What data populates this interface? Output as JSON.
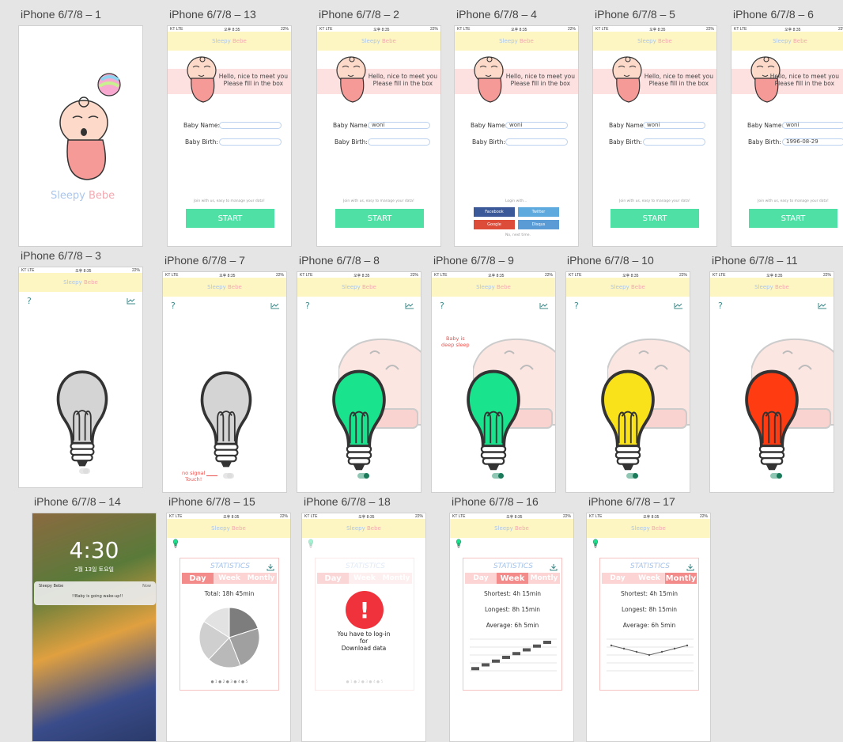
{
  "labels": {
    "s1": "iPhone 6/7/8 – 1",
    "s13": "iPhone 6/7/8 – 13",
    "s2": "iPhone 6/7/8 – 2",
    "s4": "iPhone 6/7/8 – 4",
    "s5": "iPhone 6/7/8 – 5",
    "s6": "iPhone 6/7/8 – 6",
    "s3": "iPhone 6/7/8 – 3",
    "s7": "iPhone 6/7/8 – 7",
    "s8": "iPhone 6/7/8 – 8",
    "s9": "iPhone 6/7/8 – 9",
    "s10": "iPhone 6/7/8 – 10",
    "s11": "iPhone 6/7/8 – 11",
    "s14": "iPhone 6/7/8 – 14",
    "s15": "iPhone 6/7/8 – 15",
    "s18": "iPhone 6/7/8 – 18",
    "s16": "iPhone 6/7/8 – 16",
    "s17": "iPhone 6/7/8 – 17"
  },
  "status": {
    "carrier": "KT  LTE",
    "time": "오후 8:35",
    "battery": "22%"
  },
  "brand": {
    "word1": "Sleepy",
    "word2": "Bebe"
  },
  "login": {
    "hello1": "Hello, nice to meet you",
    "hello2": "Please fill in the box",
    "name_label": "Baby Name:",
    "birth_label": "Baby Birth:",
    "name_value": "woni",
    "birth_value": "1996-08-29",
    "join": "Join with us, easy to manage your data!",
    "start": "START",
    "login_with": "Login with...",
    "social": [
      "Facebook",
      "Twitter",
      "Google",
      "Disqus"
    ],
    "no_next": "No, next time."
  },
  "monitor": {
    "help": "?",
    "no_signal": "no signal",
    "touch": "Touch!",
    "deep_sleep1": "Baby is",
    "deep_sleep2": "deep sleep"
  },
  "lock": {
    "time": "4:30",
    "date": "3월 13일 토요일",
    "app": "Sleepy Bebe",
    "now": "Now",
    "msg": "!!Baby is going wake-up!!"
  },
  "stats": {
    "title": "STATISTICS",
    "tabs": [
      "Day",
      "Week",
      "Montly"
    ],
    "total": "Total: 18h 45min",
    "shortest": "Shortest: 4h 15min",
    "longest": "Longest: 8h 15min",
    "average": "Average: 6h 5min",
    "legend": "● 1  ● 2  ● 3  ● 4  ● 5",
    "login_warn1": "You have to log-in",
    "login_warn2": "for",
    "login_warn3": "Download data"
  },
  "colors": {
    "header": "#fdf6c3",
    "accent": "#4fe0a6",
    "pink": "#fde0e0",
    "tab_active": "#f38b8b",
    "green": "#19e38d",
    "yellow": "#f9e21a",
    "red": "#ff3b12"
  },
  "icons": [
    "bulb-icon",
    "chart-icon",
    "download-icon",
    "help-icon",
    "warning-icon",
    "baby-icon"
  ],
  "chart_data": [
    {
      "type": "pie",
      "values": [
        20,
        24,
        18,
        22,
        16
      ],
      "categories": [
        "1",
        "2",
        "3",
        "4",
        "5"
      ]
    },
    {
      "type": "bar",
      "values": [
        1,
        2,
        3,
        4,
        5,
        6,
        7,
        8
      ]
    },
    {
      "type": "line",
      "values": [
        8,
        7,
        6,
        5,
        6,
        7,
        8
      ]
    }
  ]
}
